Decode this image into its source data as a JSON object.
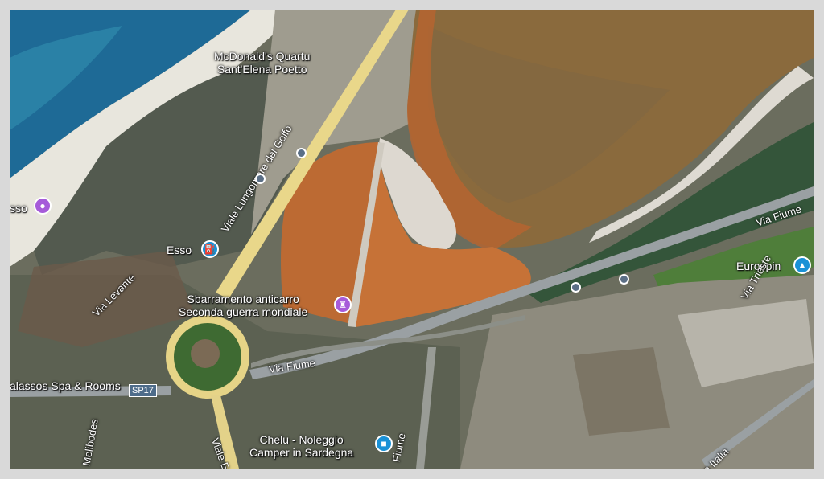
{
  "colors": {
    "sea_deep": "#1f6f9a",
    "sea_shallow": "#3b97b0",
    "beach": "#e9e7de",
    "lagoon_large": "#8e6a3c",
    "lagoon_orange": "#c67136",
    "salt_flat": "#dedad3",
    "road_yellow": "#e9d88a",
    "vegetation": "#3f5a35",
    "pin_purple": "#a65bd9",
    "pin_blue": "#1a91d6"
  },
  "labels": {
    "mcdonalds": "McDonald's Quartu\nSant'Elena Poetto",
    "esso_left": "sso",
    "esso": "Esso",
    "sbarramento": "Sbarramento anticarro\nSeconda guerra mondiale",
    "eurospin": "Eurospin",
    "thalassos": "alassos Spa & Rooms",
    "chelu": "Chelu - Noleggio\nCamper in Sardegna"
  },
  "streets": {
    "lungomare": "Viale Lungomare del Golfo",
    "via_fiume": "Via Fiume",
    "via_fiume_right": "Via Fiume",
    "via_levante": "Via Levante",
    "viale_europa": "Viale Europa",
    "via_melibodes": "Melibodes",
    "via_fiume_vertical": "Fiume",
    "via_italia": "a Italia",
    "via_trieste": "Via Trieste",
    "route_shield": "SP17"
  },
  "pins": {
    "camera_icon": "camera-icon",
    "gas_icon": "gas-station-icon",
    "monument_icon": "monument-icon",
    "shop_icon": "shopping-cart-icon",
    "lock_icon": "lock-icon"
  }
}
